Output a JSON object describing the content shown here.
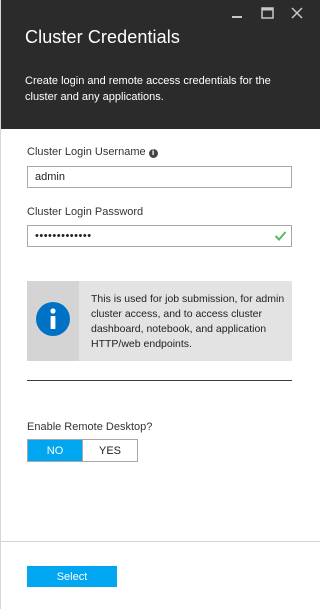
{
  "header": {
    "title": "Cluster Credentials",
    "description": "Create login and remote access credentials for the cluster and any applications.",
    "controls": {
      "minimize_icon": "minimize-icon",
      "maximize_icon": "maximize-icon",
      "close_icon": "close-icon"
    }
  },
  "form": {
    "username": {
      "label": "Cluster Login Username",
      "value": "admin",
      "info_icon": "info-icon"
    },
    "password": {
      "label": "Cluster Login Password",
      "masked_value": "•••••••••••••",
      "status_icon": "checkmark-icon",
      "status_color": "#5cb85c"
    }
  },
  "infobox": {
    "icon": "info-circle-icon",
    "icon_color": "#0072c6",
    "text": "This is used for job submission, for admin cluster access, and to access cluster dashboard, notebook, and application HTTP/web endpoints."
  },
  "remote_desktop": {
    "label": "Enable Remote Desktop?",
    "options": [
      "NO",
      "YES"
    ],
    "selected": "NO"
  },
  "footer": {
    "select_label": "Select"
  },
  "colors": {
    "header_bg": "#2b2b2b",
    "accent": "#00a6f0"
  }
}
